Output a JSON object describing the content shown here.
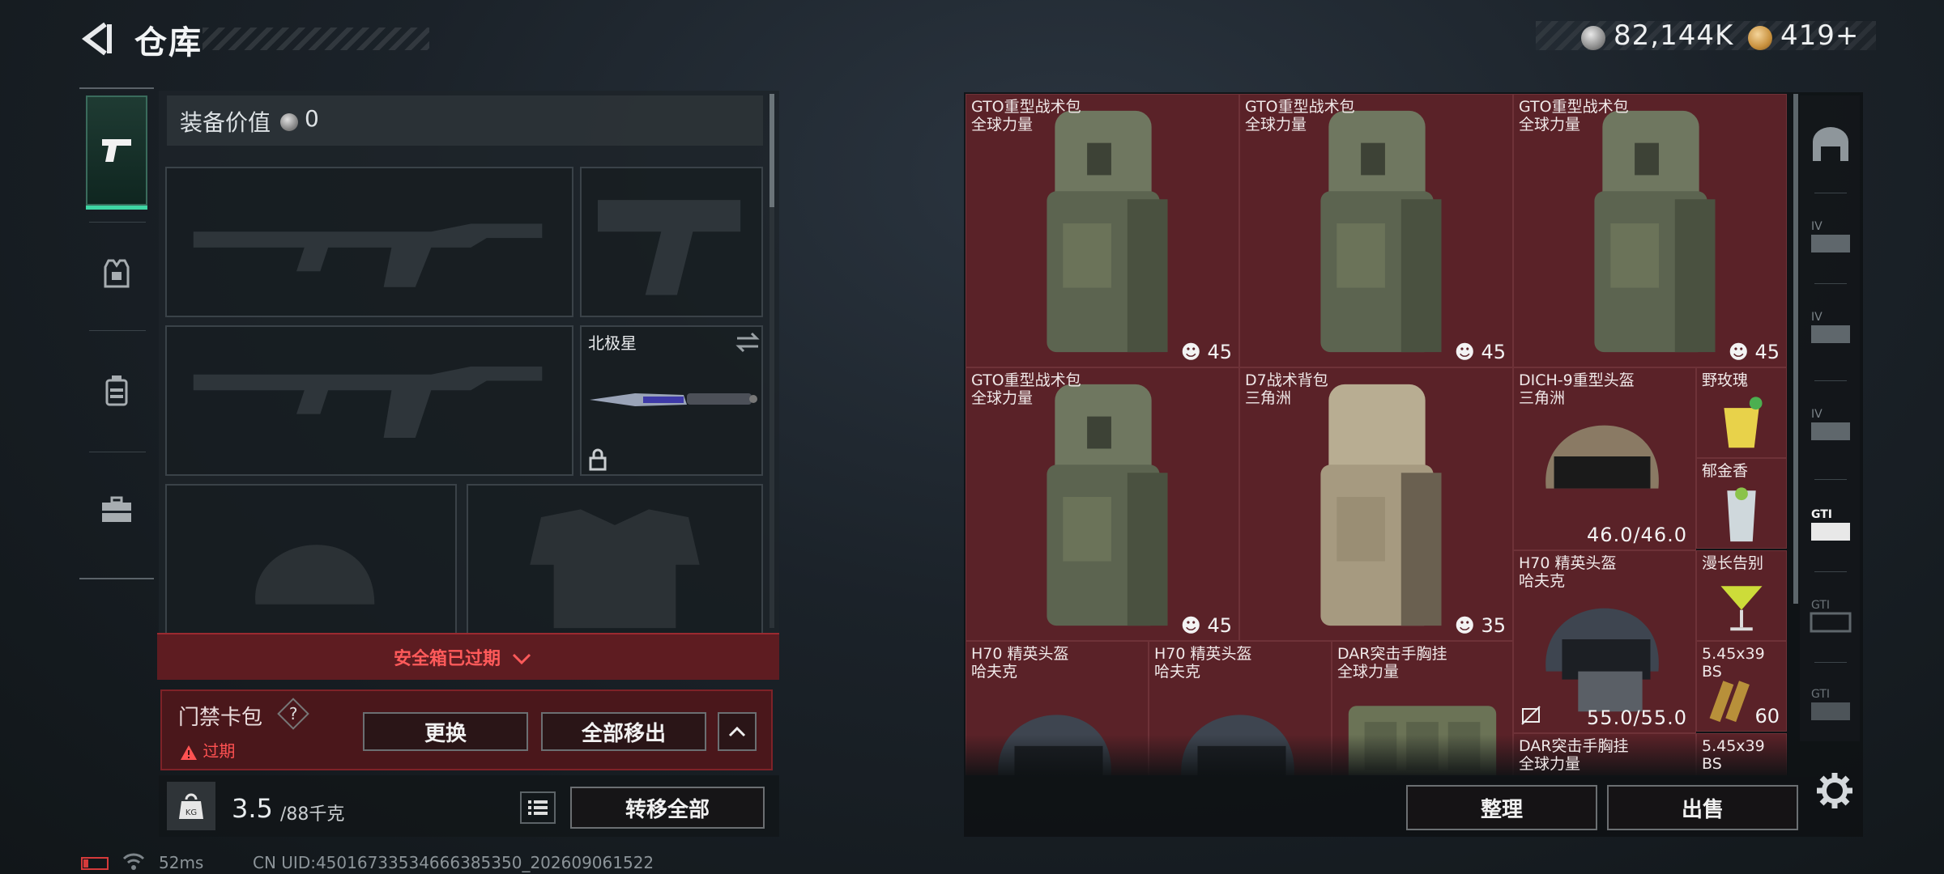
{
  "header": {
    "title": "仓库",
    "currency1": "82,144K",
    "currency2": "419+"
  },
  "loadout": {
    "value_label": "装备价值",
    "value": "0",
    "melee_label": "北极星",
    "safebox_text": "安全箱已过期",
    "keycard": {
      "title": "门禁卡包",
      "help": "?",
      "status": "过期",
      "replace_label": "更换",
      "remove_all_label": "全部移出"
    },
    "weight": {
      "icon_text": "KG",
      "current": "3.5",
      "max": "/88千克"
    },
    "transfer_all_label": "转移全部"
  },
  "status_bar": {
    "ping": "52ms",
    "uid": "CN UID:450167335346663853​50_202609061522"
  },
  "inventory": {
    "items": [
      {
        "name": "GTO重型战术包",
        "sub": "全球力量",
        "count": "45"
      },
      {
        "name": "GTO重型战术包",
        "sub": "全球力量",
        "count": "45"
      },
      {
        "name": "GTO重型战术包",
        "sub": "全球力量",
        "count": "45"
      },
      {
        "name": "GTO重型战术包",
        "sub": "全球力量",
        "count": "45"
      },
      {
        "name": "D7战术背包",
        "sub": "三角洲",
        "count": "35"
      },
      {
        "name": "DICH-9重型头盔",
        "sub": "三角洲",
        "durability": "46.0/46.0"
      },
      {
        "name": "野玫瑰"
      },
      {
        "name": "郁金香"
      },
      {
        "name": "H70 精英头盔",
        "sub": "哈夫克",
        "durability": "55.0/55.0"
      },
      {
        "name": "漫长告别"
      },
      {
        "name": "5.45x39",
        "sub": "BS",
        "count": "60"
      },
      {
        "name": "H70 精英头盔",
        "sub": "哈夫克"
      },
      {
        "name": "H70 精英头盔",
        "sub": "哈夫克"
      },
      {
        "name": "DAR突击手胸挂",
        "sub": "全球力量"
      },
      {
        "name": "DAR突击手胸挂",
        "sub": "全球力量"
      },
      {
        "name": "5.45x39",
        "sub": "BS"
      }
    ],
    "sort_label": "整理",
    "sell_label": "出售"
  },
  "right_rail": {
    "tabs": [
      "IV",
      "IV",
      "IV",
      "GTI",
      "GTI",
      "GTI"
    ]
  },
  "colors": {
    "item_bg": "#5a2228",
    "alert_red": "#ff5a5a",
    "active_green": "#3fd6a4"
  }
}
